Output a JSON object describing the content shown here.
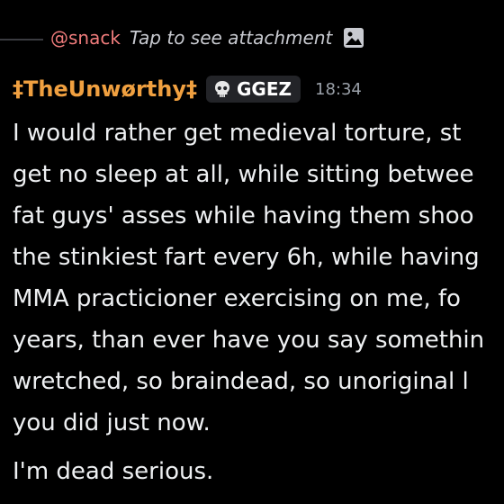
{
  "reply": {
    "mention": "@snack",
    "text": "Tap to see attachment",
    "icon": "image-icon"
  },
  "header": {
    "username": "‡TheUnwørthy‡",
    "tag_icon": "skull-icon",
    "tag": "GGEZ",
    "timestamp": "18:34"
  },
  "message": {
    "lines": [
      "I would rather get medieval torture, st",
      "get no sleep at all, while sitting betwee",
      "fat guys' asses while having them shoo",
      "the stinkiest fart every 6h, while having",
      "MMA practicioner exercising on me, fo",
      "years, than ever have you say somethin",
      "wretched, so braindead, so unoriginal l",
      "you did just now."
    ],
    "followup": "I'm dead serious."
  },
  "colors": {
    "background": "#000000",
    "username": "#f0a040",
    "mention": "#f07c7c",
    "text": "#eef0f2",
    "timestamp": "#9aa0a8",
    "badge": "#232428"
  }
}
